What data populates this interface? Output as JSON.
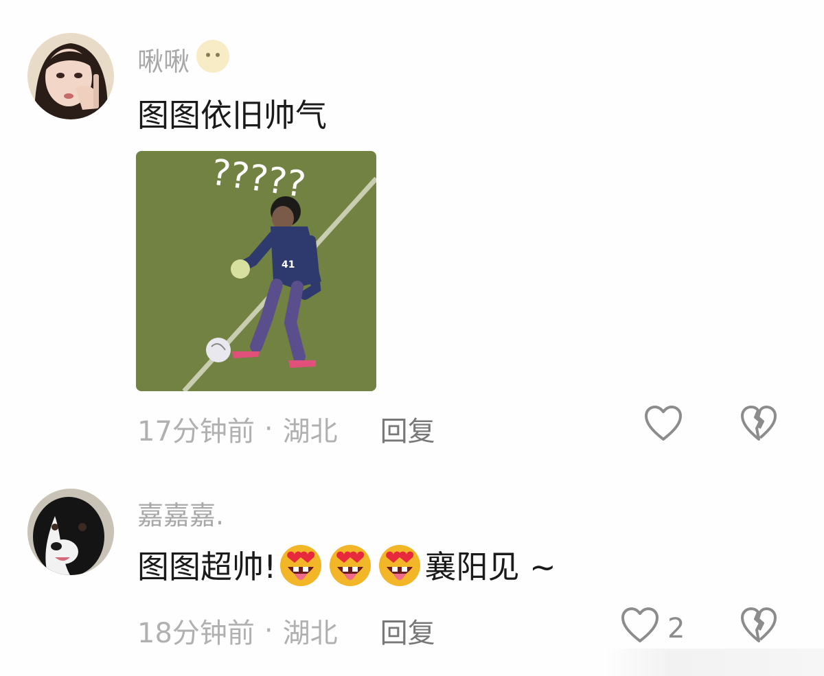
{
  "comments": [
    {
      "username": "啾啾",
      "badge_icon": "smiley-face-badge-icon",
      "text": "图图依旧帅气",
      "image": {
        "overlay_text": "?????",
        "jersey_number": "41"
      },
      "timestamp": "17分钟前",
      "location": "湖北",
      "separator": "·",
      "reply_label": "回复",
      "like_count": "",
      "avatar_desc": "woman-avatar"
    },
    {
      "username": "嘉嘉嘉.",
      "text_before": "图图超帅!",
      "emoji_names": [
        "heart-eyes-tongue-emoji",
        "heart-eyes-tongue-emoji",
        "heart-eyes-tongue-emoji"
      ],
      "text_after": "襄阳见 ~",
      "timestamp": "18分钟前",
      "location": "湖北",
      "separator": "·",
      "reply_label": "回复",
      "like_count": "2",
      "avatar_desc": "dog-avatar"
    }
  ],
  "colors": {
    "username": "#a8a8a8",
    "text": "#1a1a1a",
    "meta": "#b0b0b0",
    "icon": "#8c8c8c",
    "grass": "#6e7f3f"
  }
}
